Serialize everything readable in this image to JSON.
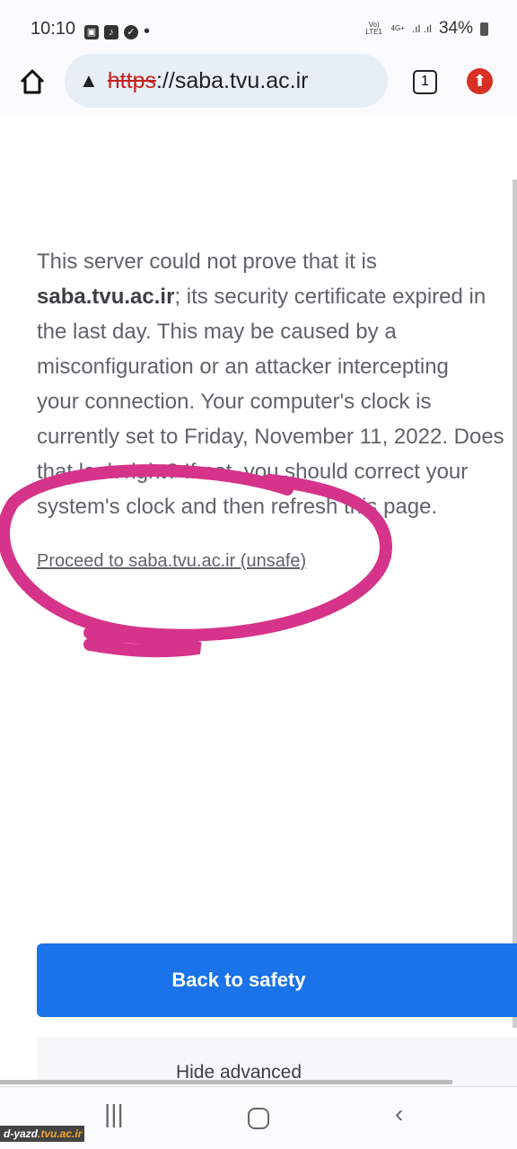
{
  "status_bar": {
    "time": "10:10",
    "network": "Vo) LTE1",
    "data": "4G+",
    "battery": "34%"
  },
  "toolbar": {
    "scheme": "https",
    "url_rest": "://saba.tvu.ac.ir",
    "tab_count": "1"
  },
  "content": {
    "lines": [
      "This server could not prove that it is",
      "saba.tvu.ac.ir",
      "; its security certificate expired in",
      "the last day. This may be caused by a",
      "misconfiguration or an attacker intercepting",
      "your connection. Your computer's clock is",
      "currently set to Friday, November 11, 2022. Does",
      "that look right? If not, you should correct your",
      "system's clock and then refresh this page."
    ],
    "proceed_link": "Proceed to saba.tvu.ac.ir (unsafe)",
    "back_button": "Back to safety",
    "hide_advanced": "Hide advanced"
  },
  "annotation_color": "#d6338a",
  "watermark": {
    "a": "d-yazd",
    "b": ".tvu.ac.ir"
  }
}
